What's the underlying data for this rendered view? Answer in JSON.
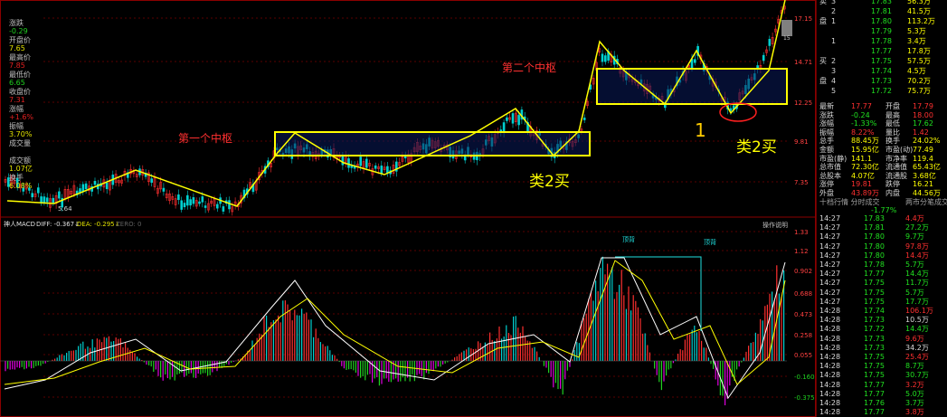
{
  "left_panel": {
    "items": [
      {
        "label": "",
        "value": "",
        "cls": "val"
      },
      {
        "label": "涨跌",
        "value": "-0.29",
        "cls": "val g"
      },
      {
        "label": "开盘价",
        "value": "7.65",
        "cls": "val y"
      },
      {
        "label": "最高价",
        "value": "7.85",
        "cls": "val"
      },
      {
        "label": "最低价",
        "value": "6.65",
        "cls": "val g"
      },
      {
        "label": "收盘价",
        "value": "7.31",
        "cls": "val"
      },
      {
        "label": "涨幅",
        "value": "+1.6%",
        "cls": "val"
      },
      {
        "label": "振幅",
        "value": "3.70%",
        "cls": "val y"
      },
      {
        "label": "成交量",
        "value": "",
        "cls": "val y"
      },
      {
        "label": "成交额",
        "value": "1.07亿",
        "cls": "val y"
      },
      {
        "label": "换手",
        "value": "6.08%",
        "cls": "val y"
      }
    ]
  },
  "main": {
    "price_ticks": [
      "17.15",
      "14.71",
      "12.25",
      "9.81",
      "7.35"
    ],
    "annotations": {
      "first_center": "第一个中枢",
      "second_center": "第二个中枢",
      "class2_buy_a": "类2买",
      "class2_buy_b": "类2买",
      "number_one": "1"
    },
    "chart_labels": {
      "low_price": "5.64",
      "highlight_box": "15"
    },
    "macd_header": {
      "title": "神人MACD",
      "diff": "DIFF: -0.367↓",
      "dea": "DEA: -0.295↓",
      "zero": "ZERO: 0"
    },
    "macd_button": "操作说明",
    "macd_ticks": [
      "1.33",
      "1.12",
      "0.902",
      "0.688",
      "0.473",
      "0.258",
      "0.055",
      "-0.160",
      "-0.375"
    ],
    "macd_tags": [
      "顶背",
      "顶背"
    ],
    "colors": {
      "up": "#ff3030",
      "down": "#00d0d0",
      "yellow": "#ffff00",
      "macd_pos": "#ff3030",
      "macd_neg": "#20d020",
      "macd_neg2": "#e000e0",
      "dif": "#ffffff",
      "dea": "#ffff00"
    }
  },
  "right_panel": {
    "orderbook": [
      {
        "side": "卖",
        "lvl": "3",
        "price": "17.83",
        "vol": "56.3万"
      },
      {
        "side": "",
        "lvl": "2",
        "price": "17.81",
        "vol": "41.5万"
      },
      {
        "side": "盘",
        "lvl": "1",
        "price": "17.80",
        "vol": "113.2万"
      },
      {
        "side": "",
        "lvl": "",
        "price": "17.79",
        "vol": "5.3万"
      },
      {
        "side": "",
        "lvl": "1",
        "price": "17.78",
        "vol": "3.4万"
      },
      {
        "side": "",
        "lvl": "",
        "price": "17.77",
        "vol": "17.8万"
      },
      {
        "side": "买",
        "lvl": "2",
        "price": "17.75",
        "vol": "57.5万"
      },
      {
        "side": "",
        "lvl": "3",
        "price": "17.74",
        "vol": "4.5万"
      },
      {
        "side": "盘",
        "lvl": "4",
        "price": "17.73",
        "vol": "70.2万"
      },
      {
        "side": "",
        "lvl": "5",
        "price": "17.72",
        "vol": "75.7万"
      }
    ],
    "quote": [
      {
        "l": "最新",
        "v": "17.77",
        "l2": "开盘",
        "v2": "17.79"
      },
      {
        "l": "涨跌",
        "v": "-0.24",
        "l2": "最高",
        "v2": "18.00"
      },
      {
        "l": "涨幅",
        "v": "-1.33%",
        "l2": "最低",
        "v2": "17.62"
      },
      {
        "l": "振幅",
        "v": "8.22%",
        "l2": "量比",
        "v2": "1.42"
      },
      {
        "l": "总手",
        "v": "88.45万",
        "l2": "换手",
        "v2": "24.02%"
      },
      {
        "l": "金额",
        "v": "15.95亿",
        "l2": "市盈(动)",
        "v2": "77.49"
      },
      {
        "l": "市盈(静)",
        "v": "141.1",
        "l2": "市净率",
        "v2": "119.4"
      },
      {
        "l": "总市值",
        "v": "72.30亿",
        "l2": "流通值",
        "v2": "65.43亿"
      },
      {
        "l": "总股本",
        "v": "4.07亿",
        "l2": "流通股",
        "v2": "3.68亿"
      },
      {
        "l": "涨停",
        "v": "19.81",
        "l2": "跌停",
        "v2": "16.21"
      },
      {
        "l": "外盘",
        "v": "43.89万",
        "l2": "内盘",
        "v2": "44.56万"
      }
    ],
    "ticks_header": {
      "left": "十档行情 分时成交",
      "right": "两市分笔成交"
    },
    "ticks_pct": "-1.77%",
    "ticks": [
      {
        "t": "14:27",
        "p": "17.83",
        "v": "4.4万",
        "c": "red"
      },
      {
        "t": "14:27",
        "p": "17.81",
        "v": "27.2万",
        "c": "green"
      },
      {
        "t": "14:27",
        "p": "17.80",
        "v": "9.7万",
        "c": "green"
      },
      {
        "t": "14:27",
        "p": "17.80",
        "v": "97.8万",
        "c": "red"
      },
      {
        "t": "14:27",
        "p": "17.80",
        "v": "14.4万",
        "c": "red"
      },
      {
        "t": "14:27",
        "p": "17.78",
        "v": "5.7万",
        "c": "green"
      },
      {
        "t": "14:27",
        "p": "17.77",
        "v": "14.4万",
        "c": "green"
      },
      {
        "t": "14:27",
        "p": "17.75",
        "v": "11.7万",
        "c": "green"
      },
      {
        "t": "14:27",
        "p": "17.75",
        "v": "5.7万",
        "c": "green"
      },
      {
        "t": "14:27",
        "p": "17.75",
        "v": "17.7万",
        "c": "green"
      },
      {
        "t": "14:28",
        "p": "17.74",
        "v": "106.1万",
        "c": "red"
      },
      {
        "t": "14:28",
        "p": "17.73",
        "v": "10.5万",
        "c": "white"
      },
      {
        "t": "14:28",
        "p": "17.72",
        "v": "14.4万",
        "c": "green"
      },
      {
        "t": "14:28",
        "p": "17.73",
        "v": "9.6万",
        "c": "red"
      },
      {
        "t": "14:28",
        "p": "17.73",
        "v": "34.2万",
        "c": "white"
      },
      {
        "t": "14:28",
        "p": "17.75",
        "v": "25.4万",
        "c": "red"
      },
      {
        "t": "14:28",
        "p": "17.75",
        "v": "8.7万",
        "c": "green"
      },
      {
        "t": "14:28",
        "p": "17.75",
        "v": "30.7万",
        "c": "green"
      },
      {
        "t": "14:28",
        "p": "17.77",
        "v": "3.2万",
        "c": "red"
      },
      {
        "t": "14:28",
        "p": "17.77",
        "v": "5.0万",
        "c": "green"
      },
      {
        "t": "14:28",
        "p": "17.76",
        "v": "3.7万",
        "c": "green"
      },
      {
        "t": "14:28",
        "p": "17.77",
        "v": "3.8万",
        "c": "red"
      }
    ]
  }
}
